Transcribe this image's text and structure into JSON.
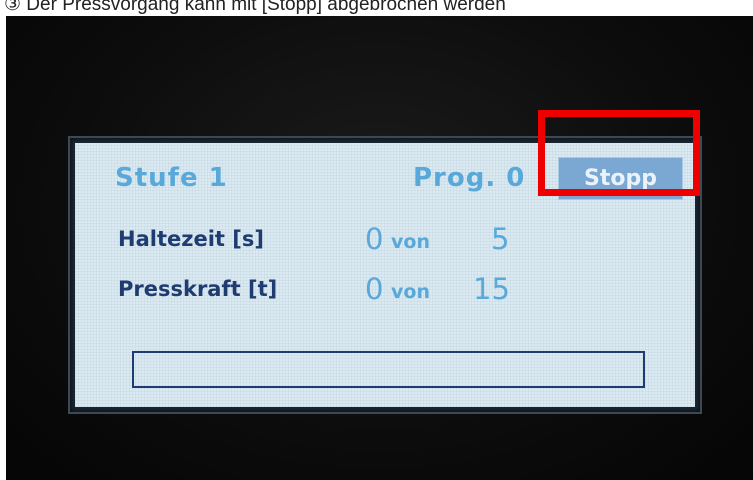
{
  "caption": {
    "text": "③ Der Pressvorgang kann mit [Stopp] abgebrochen werden"
  },
  "screen": {
    "stage_label": "Stufe 1",
    "program_label": "Prog. 0",
    "stop_button_label": "Stopp",
    "rows": [
      {
        "label": "Haltezeit [s]",
        "current": "0",
        "separator": "von",
        "target": "5"
      },
      {
        "label": "Presskraft [t]",
        "current": "0",
        "separator": "von",
        "target": "15"
      }
    ],
    "progress_fraction": 0
  },
  "colors": {
    "lcd_background": "#dbeaf2",
    "value_text": "#58a9da",
    "label_text": "#1f3c70",
    "stop_button": "#7aa8d2",
    "highlight": "#ee0000",
    "bezel": "#0c0c0c"
  }
}
